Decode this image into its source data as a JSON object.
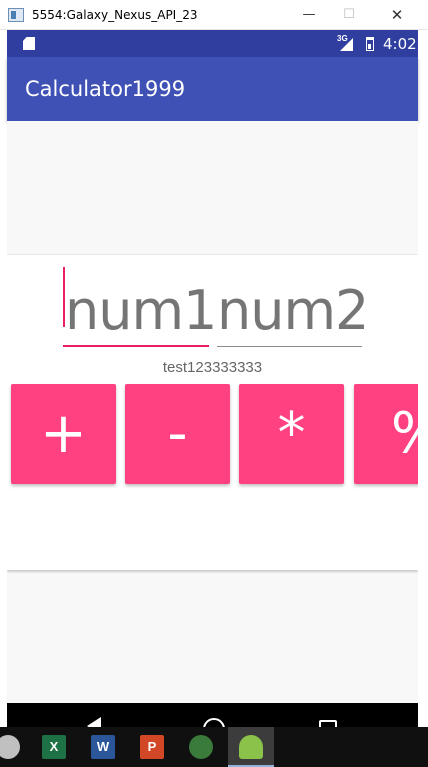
{
  "window": {
    "title": "5554:Galaxy_Nexus_API_23",
    "minimize_glyph": "—",
    "maximize_glyph": "☐",
    "close_glyph": "✕"
  },
  "status_bar": {
    "network": "3G",
    "time": "4:02",
    "icons": [
      "sd-card-icon",
      "signal-icon",
      "battery-icon"
    ],
    "color": "#303f9f"
  },
  "app_bar": {
    "title": "Calculator1999",
    "color": "#3f51b5"
  },
  "inputs": {
    "num1": {
      "hint": "num1",
      "value": ""
    },
    "num2": {
      "hint": "num2",
      "value": ""
    }
  },
  "result_text": "test123333333",
  "buttons": [
    {
      "label": "+"
    },
    {
      "label": "-"
    },
    {
      "label": "*"
    },
    {
      "label": "%"
    }
  ],
  "accent_color": "#ff4081",
  "cursor_color": "#e91e63",
  "nav_bar": {
    "icons": [
      "back-icon",
      "home-icon",
      "recents-icon"
    ]
  },
  "taskbar": {
    "items": [
      {
        "icon": "app-icon",
        "label": ""
      },
      {
        "icon": "excel-icon",
        "label": "X"
      },
      {
        "icon": "word-icon",
        "label": "W"
      },
      {
        "icon": "powerpoint-icon",
        "label": "P"
      },
      {
        "icon": "android-studio-icon",
        "label": ""
      },
      {
        "icon": "android-emulator-icon",
        "label": ""
      }
    ]
  }
}
